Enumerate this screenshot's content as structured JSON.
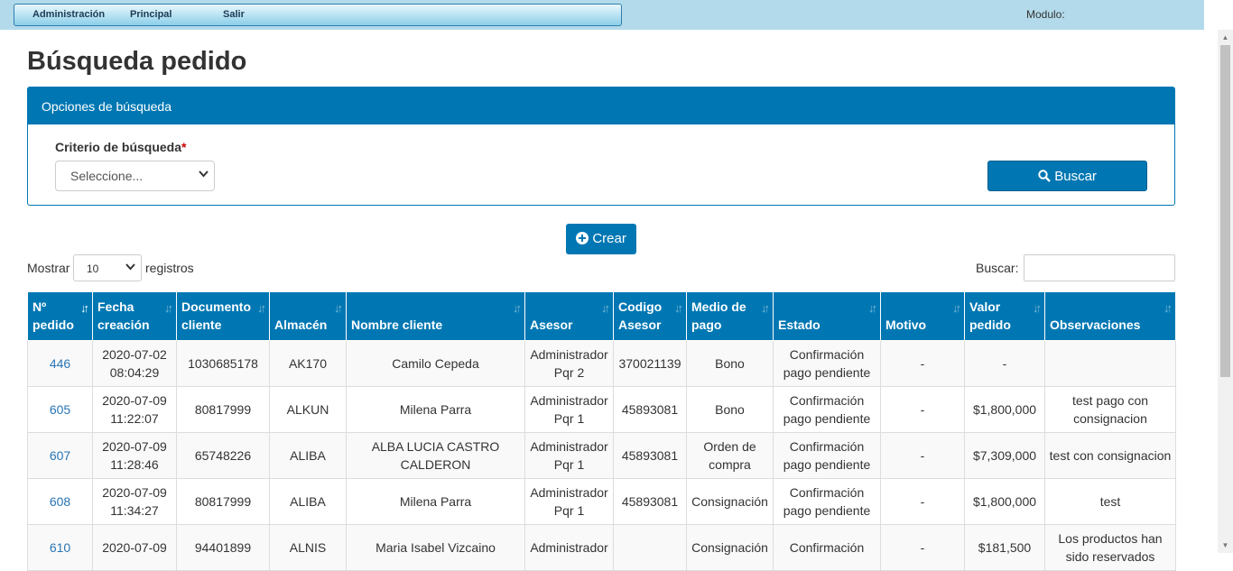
{
  "menu": {
    "items": [
      "Administración",
      "Principal",
      "Salir"
    ],
    "modulo_label": "Modulo:"
  },
  "page": {
    "title": "Búsqueda pedido"
  },
  "search_panel": {
    "heading": "Opciones de búsqueda",
    "criterio_label": "Criterio de búsqueda",
    "required_mark": "*",
    "criterio_value": "Seleccione...",
    "buscar_button": "Buscar"
  },
  "crear_button": "Crear",
  "table_controls": {
    "mostrar_label": "Mostrar",
    "page_length": "10",
    "registros_label": "registros",
    "buscar_label": "Buscar:"
  },
  "table": {
    "headers": [
      "Nº pedido",
      "Fecha creación",
      "Documento cliente",
      "Almacén",
      "Nombre cliente",
      "Asesor",
      "Codigo Asesor",
      "Medio de pago",
      "Estado",
      "Motivo",
      "Valor pedido",
      "Observaciones"
    ],
    "rows": [
      [
        "446",
        "2020-07-02 08:04:29",
        "1030685178",
        "AK170",
        "Camilo Cepeda",
        "Administrador Pqr 2",
        "370021139",
        "Bono",
        "Confirmación pago pendiente",
        "-",
        "-",
        ""
      ],
      [
        "605",
        "2020-07-09 11:22:07",
        "80817999",
        "ALKUN",
        "Milena Parra",
        "Administrador Pqr 1",
        "45893081",
        "Bono",
        "Confirmación pago pendiente",
        "-",
        "$1,800,000",
        "test pago con consignacion"
      ],
      [
        "607",
        "2020-07-09 11:28:46",
        "65748226",
        "ALIBA",
        "ALBA LUCIA CASTRO CALDERON",
        "Administrador Pqr 1",
        "45893081",
        "Orden de compra",
        "Confirmación pago pendiente",
        "-",
        "$7,309,000",
        "test con consignacion"
      ],
      [
        "608",
        "2020-07-09 11:34:27",
        "80817999",
        "ALIBA",
        "Milena Parra",
        "Administrador Pqr 1",
        "45893081",
        "Consignación",
        "Confirmación pago pendiente",
        "-",
        "$1,800,000",
        "test"
      ],
      [
        "610",
        "2020-07-09",
        "94401899",
        "ALNIS",
        "Maria Isabel Vizcaino",
        "Administrador",
        "",
        "Consignación",
        "Confirmación",
        "-",
        "$181,500",
        "Los productos han sido reservados"
      ]
    ]
  }
}
